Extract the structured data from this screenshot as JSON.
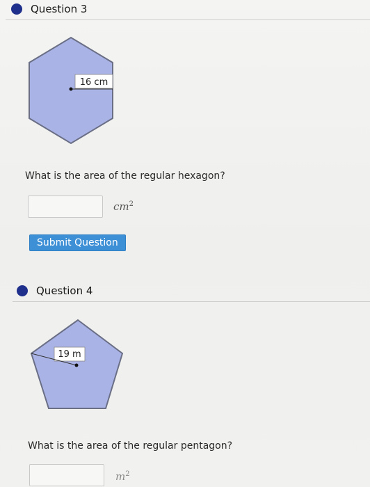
{
  "question3": {
    "title": "Question 3",
    "figure_label": "16 cm",
    "prompt": "What is the area of the regular hexagon?",
    "answer_value": "",
    "unit": "cm",
    "unit_exponent": "2",
    "submit_label": "Submit Question"
  },
  "question4": {
    "title": "Question 4",
    "figure_label": "19 m",
    "prompt": "What is the area of the regular pentagon?",
    "answer_value": "",
    "unit": "m",
    "unit_exponent": "2"
  },
  "colors": {
    "accent_dot": "#1f2f8c",
    "shape_fill": "#a9b3e6",
    "shape_stroke": "#6a6f86",
    "submit_button": "#3d8fd6"
  },
  "icons": {
    "question_marker": "filled-circle-icon"
  }
}
